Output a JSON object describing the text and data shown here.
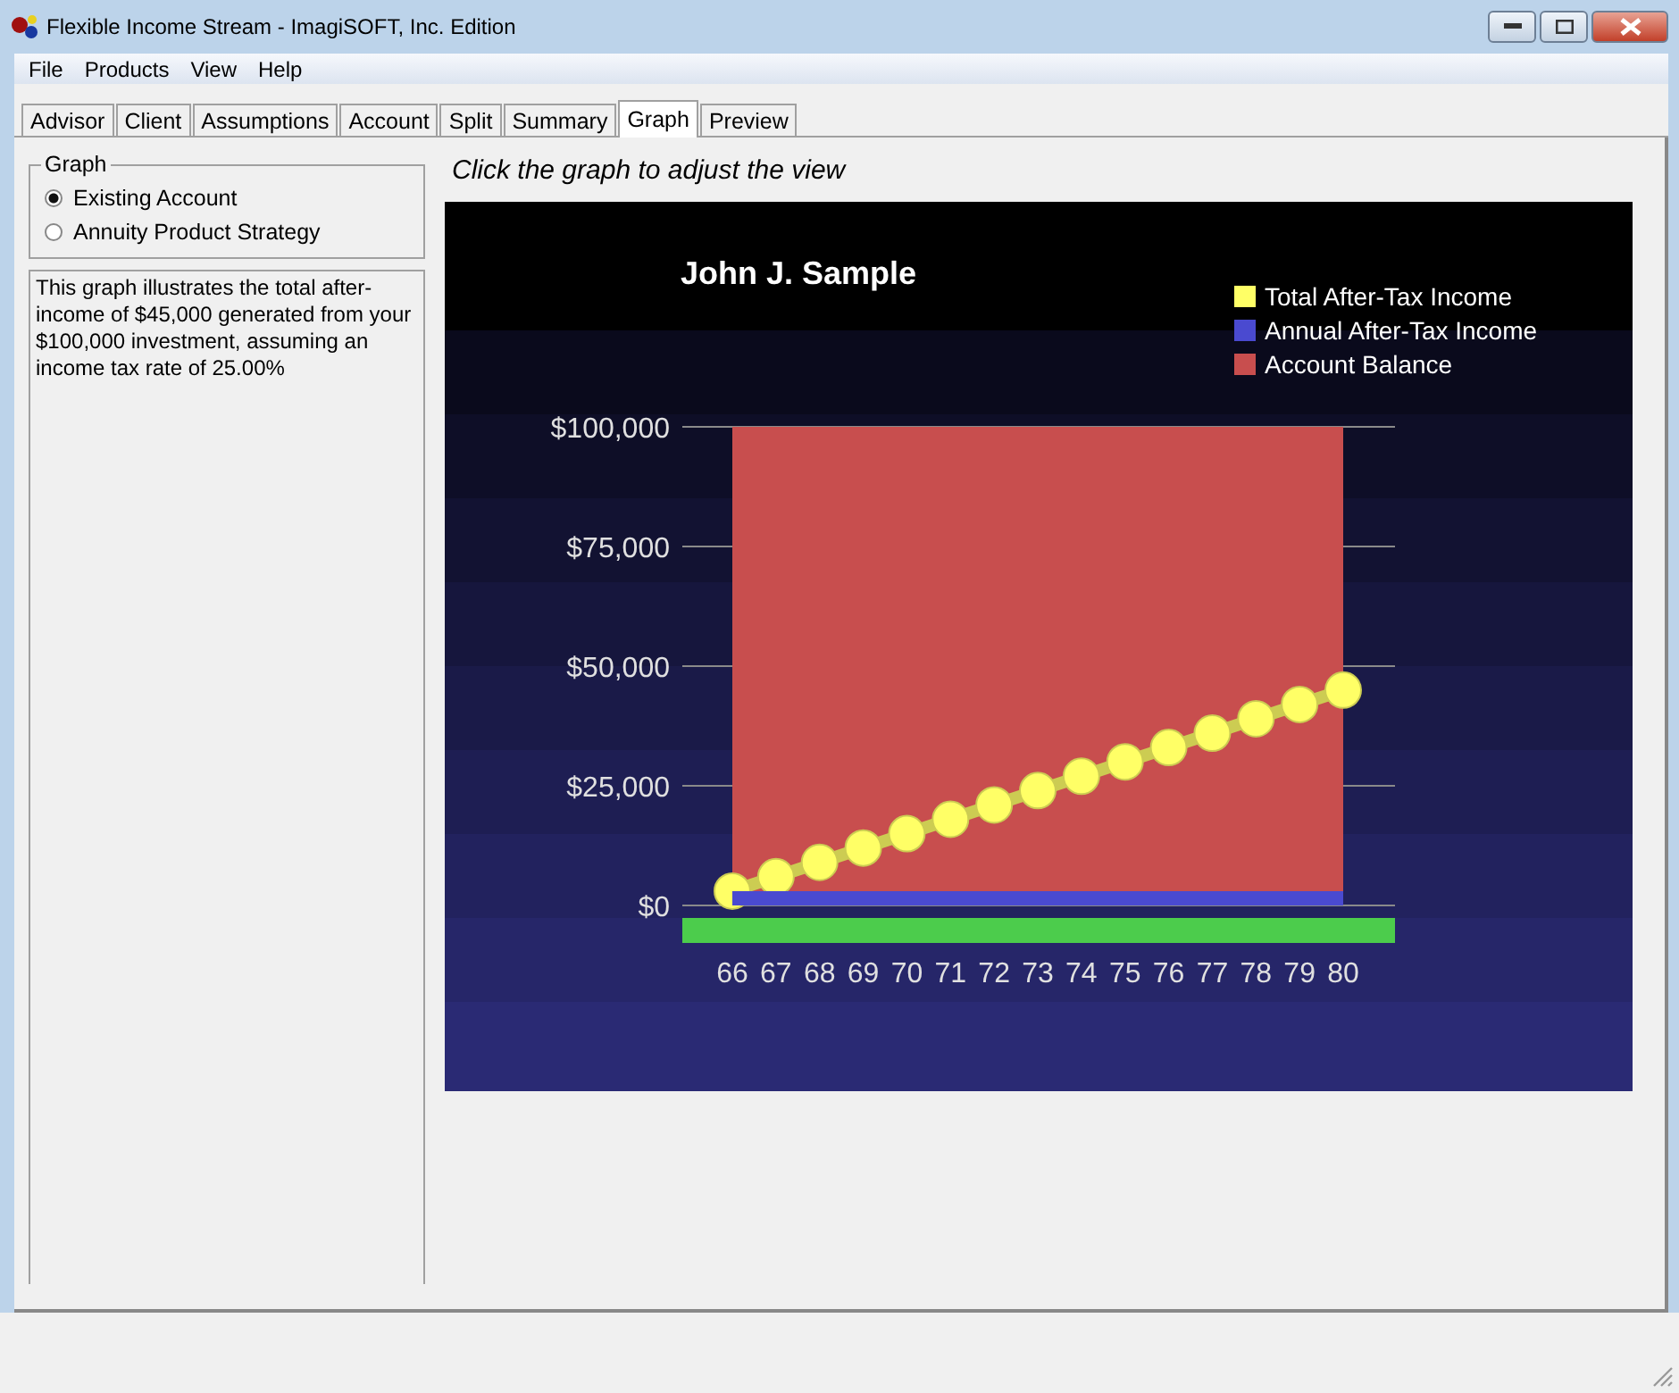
{
  "window": {
    "title": "Flexible Income Stream - ImagiSOFT, Inc. Edition"
  },
  "menu": [
    "File",
    "Products",
    "View",
    "Help"
  ],
  "tabs": [
    {
      "label": "Advisor",
      "selected": false
    },
    {
      "label": "Client",
      "selected": false
    },
    {
      "label": "Assumptions",
      "selected": false
    },
    {
      "label": "Account",
      "selected": false
    },
    {
      "label": "Split",
      "selected": false
    },
    {
      "label": "Summary",
      "selected": false
    },
    {
      "label": "Graph",
      "selected": true
    },
    {
      "label": "Preview",
      "selected": false
    }
  ],
  "graph_group": {
    "title": "Graph",
    "options": [
      {
        "label": "Existing Account",
        "selected": true
      },
      {
        "label": "Annuity Product Strategy",
        "selected": false
      }
    ]
  },
  "description": "This graph illustrates the total after-income of $45,000 generated from your $100,000 investment, assuming an income tax rate of 25.00%",
  "hint": "Click the graph to adjust the view",
  "chart": {
    "chart_data": {
      "type": "line",
      "title": "John J. Sample",
      "categories": [
        "66",
        "67",
        "68",
        "69",
        "70",
        "71",
        "72",
        "73",
        "74",
        "75",
        "76",
        "77",
        "78",
        "79",
        "80"
      ],
      "series": [
        {
          "name": "Total After-Tax Income",
          "type": "line",
          "marker": "circle",
          "color": "#ffff66",
          "values": [
            3000,
            6000,
            9000,
            12000,
            15000,
            18000,
            21000,
            24000,
            27000,
            30000,
            33000,
            36000,
            39000,
            42000,
            45000
          ]
        },
        {
          "name": "Annual After-Tax Income",
          "type": "area",
          "color": "#4a4ad0",
          "values": [
            3000,
            3000,
            3000,
            3000,
            3000,
            3000,
            3000,
            3000,
            3000,
            3000,
            3000,
            3000,
            3000,
            3000,
            3000
          ]
        },
        {
          "name": "Account Balance",
          "type": "area",
          "color": "#c84e4e",
          "values": [
            100000,
            100000,
            100000,
            100000,
            100000,
            100000,
            100000,
            100000,
            100000,
            100000,
            100000,
            100000,
            100000,
            100000,
            100000
          ]
        }
      ],
      "ylim": [
        0,
        100000
      ],
      "grid": true,
      "legend": "upper right",
      "yticks": [
        {
          "value": 0,
          "label": "$0"
        },
        {
          "value": 25000,
          "label": "$25,000"
        },
        {
          "value": 50000,
          "label": "$50,000"
        },
        {
          "value": 75000,
          "label": "$75,000"
        },
        {
          "value": 100000,
          "label": "$100,000"
        }
      ]
    }
  }
}
